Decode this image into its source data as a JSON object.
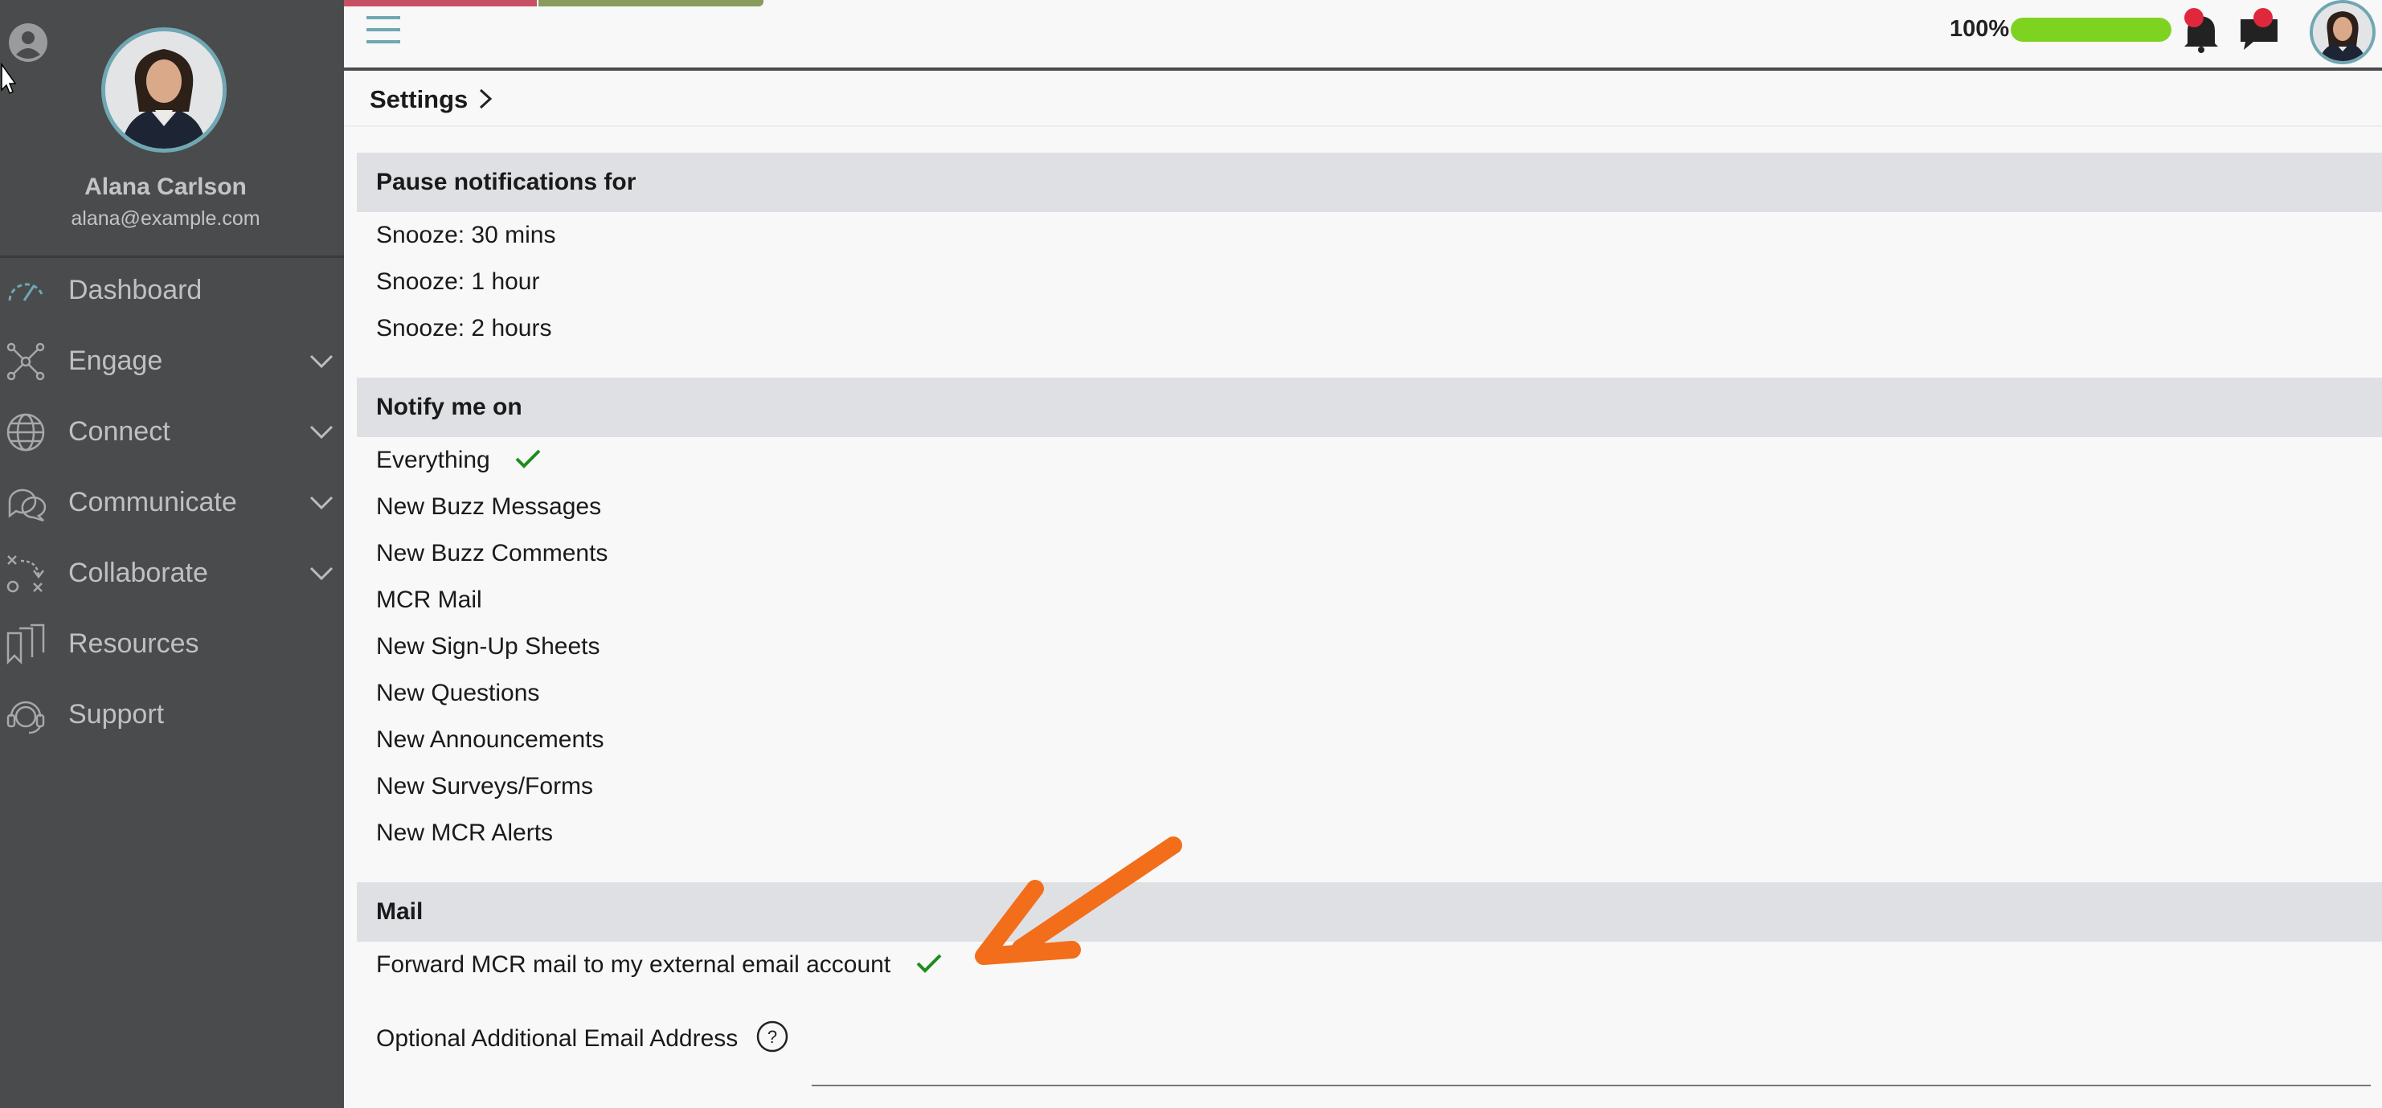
{
  "colors": {
    "sidebar_bg": "#4a4b4d",
    "accent_teal": "#6fa7b3",
    "progress_green": "#7ed321",
    "check_green": "#1e8c1e",
    "annotation_orange": "#f26e1b",
    "notification_red": "#e0283c"
  },
  "sidebar": {
    "user_name": "Alana Carlson",
    "user_email": "alana@example.com",
    "items": [
      {
        "label": "Dashboard",
        "icon": "gauge-icon",
        "expandable": false
      },
      {
        "label": "Engage",
        "icon": "network-icon",
        "expandable": true
      },
      {
        "label": "Connect",
        "icon": "globe-icon",
        "expandable": true
      },
      {
        "label": "Communicate",
        "icon": "chat-bubbles-icon",
        "expandable": true
      },
      {
        "label": "Collaborate",
        "icon": "strategy-icon",
        "expandable": true
      },
      {
        "label": "Resources",
        "icon": "bookmarks-icon",
        "expandable": false
      },
      {
        "label": "Support",
        "icon": "headset-icon",
        "expandable": false
      }
    ]
  },
  "topbar": {
    "progress_label": "100%",
    "progress_value": 1.0
  },
  "breadcrumb": {
    "label": "Settings"
  },
  "sections": {
    "pause": {
      "title": "Pause notifications for",
      "options": [
        "Snooze: 30 mins",
        "Snooze: 1 hour",
        "Snooze: 2 hours"
      ]
    },
    "notify": {
      "title": "Notify me on",
      "options": [
        {
          "label": "Everything",
          "checked": true
        },
        {
          "label": "New Buzz Messages",
          "checked": false
        },
        {
          "label": "New Buzz Comments",
          "checked": false
        },
        {
          "label": "MCR Mail",
          "checked": false
        },
        {
          "label": "New Sign-Up Sheets",
          "checked": false
        },
        {
          "label": "New Questions",
          "checked": false
        },
        {
          "label": "New Announcements",
          "checked": false
        },
        {
          "label": "New Surveys/Forms",
          "checked": false
        },
        {
          "label": "New MCR Alerts",
          "checked": false
        }
      ]
    },
    "mail": {
      "title": "Mail",
      "forward_label": "Forward MCR mail to my external email account",
      "forward_checked": true,
      "additional_email_label": "Optional Additional Email Address",
      "additional_email_value": ""
    }
  }
}
